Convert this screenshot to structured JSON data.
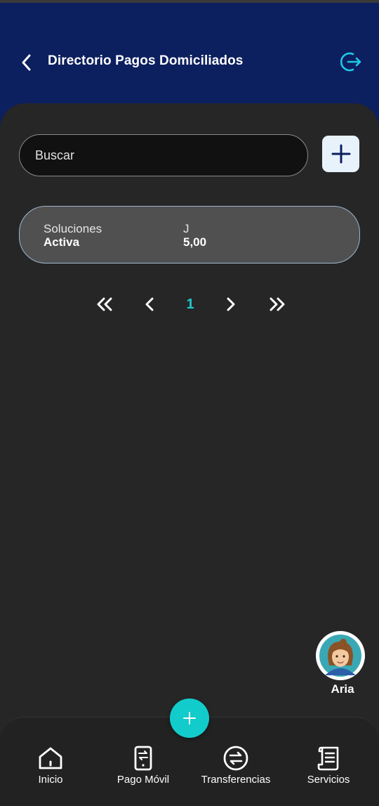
{
  "header": {
    "title": "Directorio Pagos Domiciliados",
    "back_icon": "chevron-left-icon",
    "logout_icon": "logout-icon"
  },
  "search": {
    "placeholder": "Buscar",
    "value": ""
  },
  "add_button": {
    "icon": "plus-icon"
  },
  "records": [
    {
      "name": "Soluciones",
      "status": "Activa",
      "type": "J",
      "amount": "5,00"
    }
  ],
  "pagination": {
    "current_page": "1",
    "first_icon": "double-chevron-left-icon",
    "prev_icon": "chevron-left-icon",
    "next_icon": "chevron-right-icon",
    "last_icon": "double-chevron-right-icon"
  },
  "assistant": {
    "name": "Aria"
  },
  "bottom_nav": {
    "items": [
      {
        "label": "Inicio",
        "icon": "home-icon"
      },
      {
        "label": "Pago Móvil",
        "icon": "mobile-payment-icon"
      },
      {
        "label": "Transferencias",
        "icon": "transfer-icon"
      },
      {
        "label": "Servicios",
        "icon": "receipt-icon"
      }
    ],
    "fab_icon": "plus-icon"
  },
  "colors": {
    "header_bg": "#0c1f5e",
    "accent": "#12cccc",
    "background": "#262626"
  }
}
